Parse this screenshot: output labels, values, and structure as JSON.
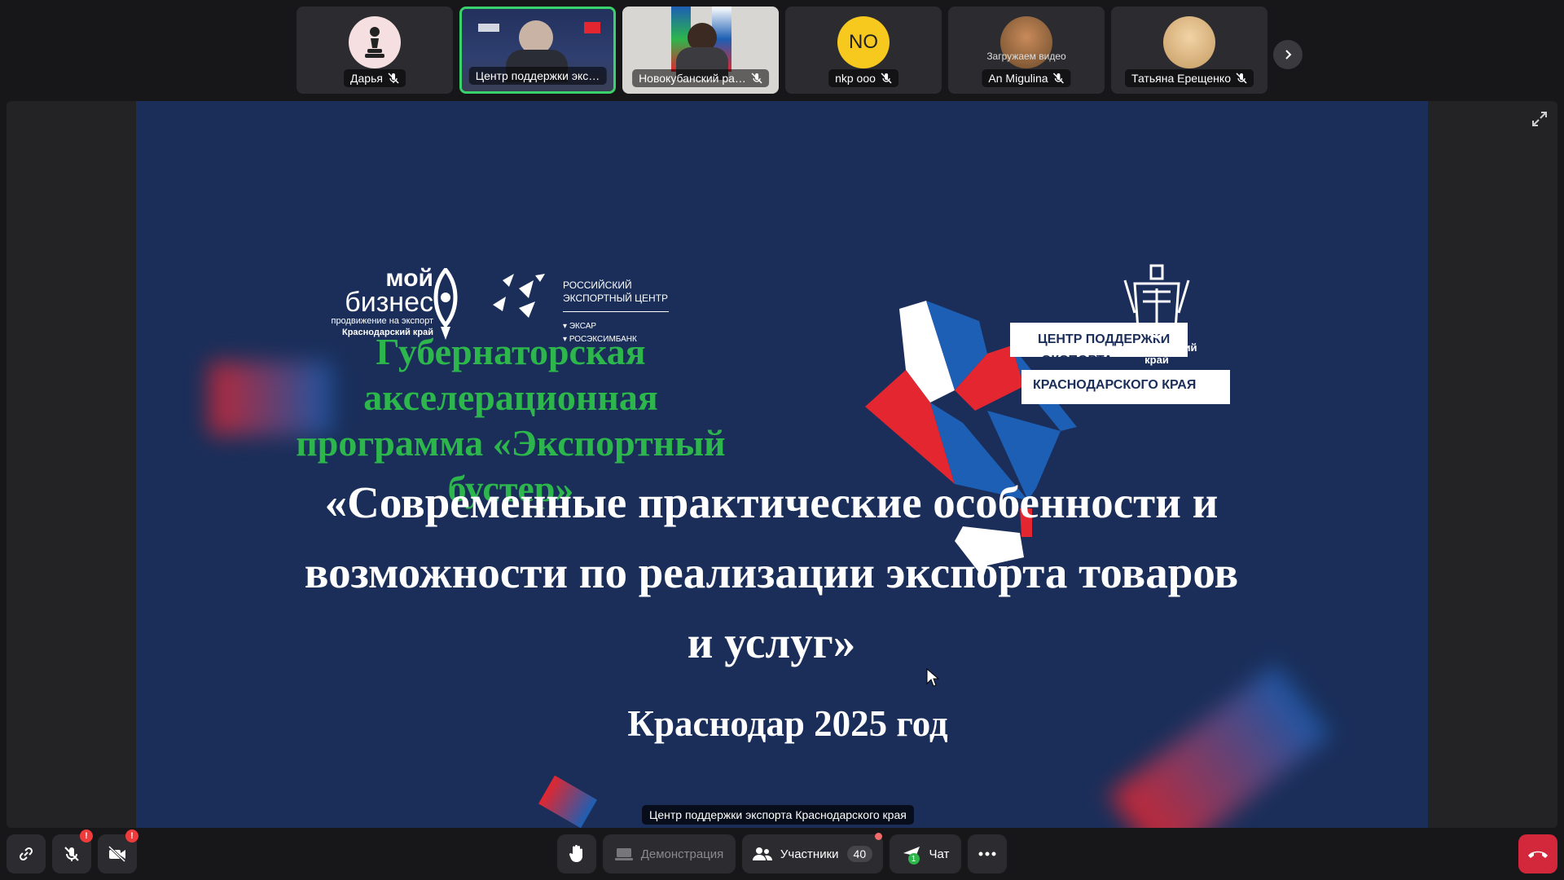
{
  "participants": [
    {
      "name": "Дарья",
      "avatar": "pawn-icon"
    },
    {
      "name": "Центр поддержки экс…",
      "avatar": "video"
    },
    {
      "name": "Новокубанский ра…",
      "avatar": "video"
    },
    {
      "name": "nkp ooo",
      "avatar_initials": "NO",
      "avatar_color": "#f7c81d"
    },
    {
      "name": "An Migulina",
      "overlay": "Загружаем видео",
      "avatar": "photo"
    },
    {
      "name": "Татьяна Ерещенко",
      "avatar": "photo"
    }
  ],
  "slide": {
    "logo_mb": {
      "line1": "мой",
      "line2": "бизнес",
      "line3": "продвижение на экспорт",
      "line4": "Краснодарский край"
    },
    "logo_rec": {
      "line1": "РОССИЙСКИЙ",
      "line2": "ЭКСПОРТНЫЙ ЦЕНТР",
      "line3": "ЭКСАР",
      "line4": "РОСЭКСИМБАНК"
    },
    "logo_region": {
      "line1": "Краснодарский",
      "line2": "край"
    },
    "center_label": {
      "line1": "ЦЕНТР ПОДДЕРЖКИ",
      "line2": "ЭКСПОРТА",
      "line3": "КРАСНОДАРСКОГО КРАЯ"
    },
    "program_line1": "Губернаторская акселерационная",
    "program_line2": "программа «Экспортный бустер»",
    "title_line1": "«Современные практические особенности и",
    "title_line2": "возможности по реализации экспорта товаров",
    "title_line3": "и услуг»",
    "city_year": "Краснодар 2025 год",
    "colors": {
      "background": "#1a2e59",
      "green": "#2cb64c",
      "red": "#e3262f",
      "blue": "#1d5fb4"
    }
  },
  "caption": "Центр поддержки экспорта Краснодарского края",
  "toolbar": {
    "link_icon": "link-icon",
    "mic_alert": "!",
    "cam_alert": "!",
    "demo_label": "Демонстрация",
    "participants_label": "Участники",
    "participants_count": "40",
    "chat_label": "Чат",
    "chat_badge": "1",
    "more_icon": "more-icon",
    "hangup_icon": "hangup-icon"
  }
}
